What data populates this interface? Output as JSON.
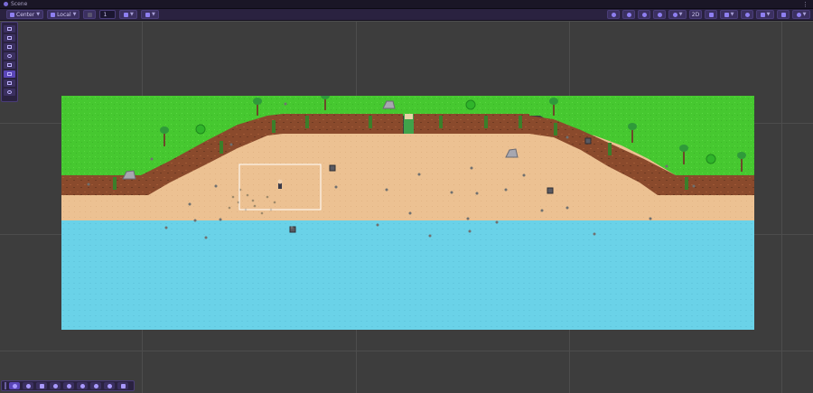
{
  "window": {
    "title": "Scene",
    "menu_icon": "kebab-menu-icon"
  },
  "toolbar": {
    "pivot_mode": "Center",
    "space_mode": "Local",
    "snap_increment": "1",
    "right_label": "2D"
  },
  "colors": {
    "grass": "#46c830",
    "dirt": "#8a4a2c",
    "sand": "#ecc192",
    "water": "#6ad2e8",
    "accent": "#5a46b8"
  },
  "side_tools": [
    "view-tool-icon",
    "hand-tool-icon",
    "move-tool-icon",
    "rotate-tool-icon",
    "scale-tool-icon",
    "rect-tool-icon",
    "transform-tool-icon",
    "custom-tool-icon"
  ],
  "bottom_tools": [
    "brush-icon",
    "picker-icon",
    "box-fill-icon",
    "fill-icon",
    "eraser-icon",
    "zoom-icon",
    "palette-icon",
    "select-icon",
    "move-icon"
  ]
}
